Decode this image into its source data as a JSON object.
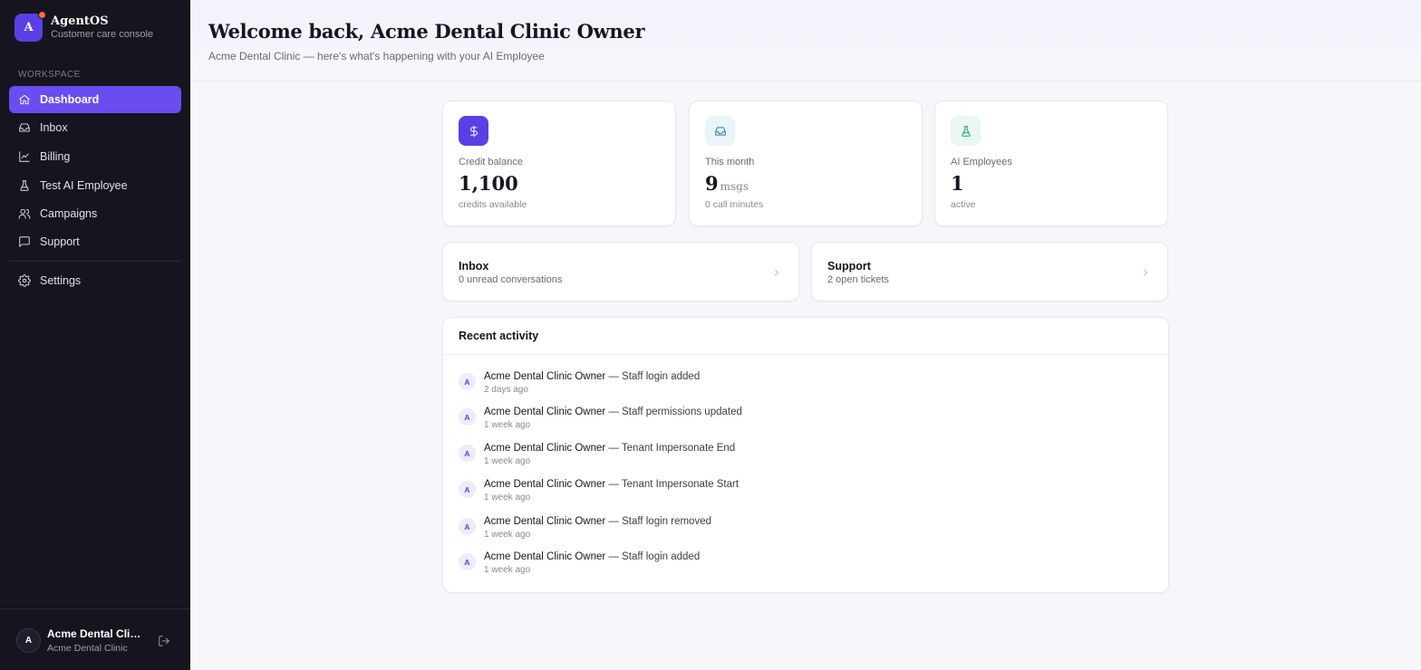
{
  "brand": {
    "logo_letter": "A",
    "name": "AgentOS",
    "subtitle": "Customer care console"
  },
  "sidebar": {
    "section_label": "WORKSPACE",
    "items": [
      {
        "label": "Dashboard",
        "icon": "home-icon",
        "active": true
      },
      {
        "label": "Inbox",
        "icon": "inbox-icon"
      },
      {
        "label": "Billing",
        "icon": "chart-line-icon"
      },
      {
        "label": "Test AI Employee",
        "icon": "flask-icon"
      },
      {
        "label": "Campaigns",
        "icon": "users-icon"
      },
      {
        "label": "Support",
        "icon": "message-square-icon"
      },
      {
        "label": "Settings",
        "icon": "gear-icon"
      }
    ],
    "user": {
      "avatar_letter": "A",
      "name": "Acme Dental Clinic...",
      "org": "Acme Dental Clinic"
    }
  },
  "header": {
    "title": "Welcome back, Acme Dental Clinic Owner",
    "subtitle": "Acme Dental Clinic — here's what's happening with your AI Employee"
  },
  "stats": [
    {
      "label": "Credit balance",
      "value": "1,100",
      "unit": "",
      "note": "credits available",
      "icon": "dollar-icon",
      "color": "#5b3fe6"
    },
    {
      "label": "This month",
      "value": "9",
      "unit": "msgs",
      "note": "0 call minutes",
      "icon": "inbox-icon",
      "color": "#2b7fb8"
    },
    {
      "label": "AI Employees",
      "value": "1",
      "unit": "",
      "note": "active",
      "icon": "flask-icon",
      "color": "#22a06b"
    }
  ],
  "links": [
    {
      "title": "Inbox",
      "subtitle": "0 unread conversations"
    },
    {
      "title": "Support",
      "subtitle": "2 open tickets"
    }
  ],
  "activity": {
    "title": "Recent activity",
    "items": [
      {
        "avatar": "A",
        "actor": "Acme Dental Clinic Owner",
        "action": " — Staff login added",
        "time": "2 days ago"
      },
      {
        "avatar": "A",
        "actor": "Acme Dental Clinic Owner",
        "action": " — Staff permissions updated",
        "time": "1 week ago"
      },
      {
        "avatar": "A",
        "actor": "Acme Dental Clinic Owner",
        "action": " — Tenant Impersonate End",
        "time": "1 week ago"
      },
      {
        "avatar": "A",
        "actor": "Acme Dental Clinic Owner",
        "action": " — Tenant Impersonate Start",
        "time": "1 week ago"
      },
      {
        "avatar": "A",
        "actor": "Acme Dental Clinic Owner",
        "action": " — Staff login removed",
        "time": "1 week ago"
      },
      {
        "avatar": "A",
        "actor": "Acme Dental Clinic Owner",
        "action": " — Staff login added",
        "time": "1 week ago"
      }
    ]
  }
}
